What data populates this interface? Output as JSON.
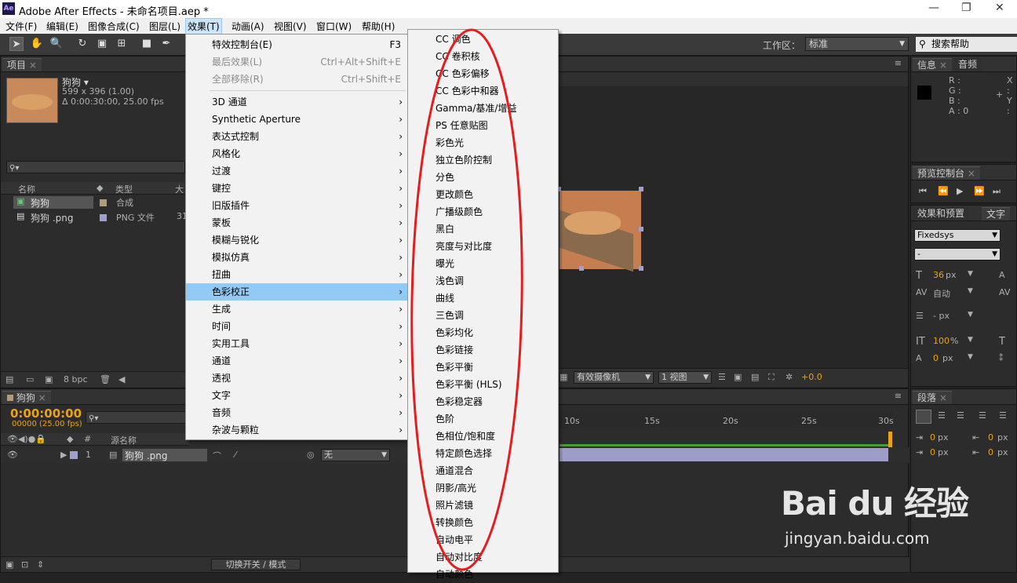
{
  "window": {
    "title": "Adobe After Effects - 未命名项目.aep *",
    "logo_text": "Ae",
    "minimize": "—",
    "restore": "❐",
    "close": "✕"
  },
  "menubar": {
    "items": [
      "文件(F)",
      "编辑(E)",
      "图像合成(C)",
      "图层(L)",
      "效果(T)",
      "动画(A)",
      "视图(V)",
      "窗口(W)",
      "帮助(H)"
    ]
  },
  "toolbar": {
    "workspace_label": "工作区：",
    "workspace_value": "标准",
    "search_placeholder": "搜索帮助"
  },
  "project_panel": {
    "tab": "项目",
    "item_name": "狗狗 ▾",
    "item_size": "599 x 396 (1.00)",
    "item_duration": "Δ 0:00:30:00, 25.00 fps",
    "col_name": "名称",
    "col_type": "类型",
    "col_size": "大",
    "rows": [
      {
        "name": "狗狗",
        "type": "合成",
        "size": ""
      },
      {
        "name": "狗狗 .png",
        "type": "PNG 文件",
        "size": "31"
      }
    ],
    "bpc": "8 bpc"
  },
  "effects_menu": {
    "items": [
      {
        "label": "特效控制台(E)",
        "shortcut": "F3",
        "disabled": false,
        "submenu": false
      },
      {
        "label": "最后效果(L)",
        "shortcut": "Ctrl+Alt+Shift+E",
        "disabled": true,
        "submenu": false
      },
      {
        "label": "全部移除(R)",
        "shortcut": "Ctrl+Shift+E",
        "disabled": true,
        "submenu": false
      },
      {
        "label": "3D 通道",
        "submenu": true
      },
      {
        "label": "Synthetic Aperture",
        "submenu": true
      },
      {
        "label": "表达式控制",
        "submenu": true
      },
      {
        "label": "风格化",
        "submenu": true
      },
      {
        "label": "过渡",
        "submenu": true
      },
      {
        "label": "键控",
        "submenu": true
      },
      {
        "label": "旧版插件",
        "submenu": true
      },
      {
        "label": "蒙板",
        "submenu": true
      },
      {
        "label": "模糊与锐化",
        "submenu": true
      },
      {
        "label": "模拟仿真",
        "submenu": true
      },
      {
        "label": "扭曲",
        "submenu": true
      },
      {
        "label": "色彩校正",
        "submenu": true,
        "highlighted": true
      },
      {
        "label": "生成",
        "submenu": true
      },
      {
        "label": "时间",
        "submenu": true
      },
      {
        "label": "实用工具",
        "submenu": true
      },
      {
        "label": "通道",
        "submenu": true
      },
      {
        "label": "透视",
        "submenu": true
      },
      {
        "label": "文字",
        "submenu": true
      },
      {
        "label": "音频",
        "submenu": true
      },
      {
        "label": "杂波与颗粒",
        "submenu": true
      }
    ],
    "arrow": "›"
  },
  "color_submenu": {
    "items": [
      "CC 调色",
      "CC 卷积核",
      "CC 色彩偏移",
      "CC 色彩中和器",
      "Gamma/基准/增益",
      "PS 任意贴图",
      "彩色光",
      "独立色阶控制",
      "分色",
      "更改颜色",
      "广播级颜色",
      "黑白",
      "亮度与对比度",
      "曝光",
      "浅色调",
      "曲线",
      "三色调",
      "色彩均化",
      "色彩链接",
      "色彩平衡",
      "色彩平衡 (HLS)",
      "色彩稳定器",
      "色阶",
      "色相位/饱和度",
      "特定颜色选择",
      "通道混合",
      "阴影/高光",
      "照片滤镜",
      "转换颜色",
      "自动电平",
      "自动对比度",
      "自动颜色"
    ]
  },
  "viewer": {
    "camera": "有效摄像机",
    "views": "1 视图",
    "exposure": "+0.0"
  },
  "info_panel": {
    "tab_info": "信息",
    "tab_audio": "音频",
    "r": "R :",
    "g": "G :",
    "b": "B :",
    "a": "A : 0",
    "x": "X :",
    "y": "Y :"
  },
  "preview_panel": {
    "tab": "预览控制台"
  },
  "character_panel": {
    "tab_effects": "效果和预置",
    "tab_text": "文字",
    "font": "Fixedsys",
    "style": "-",
    "size": "36",
    "px": "px",
    "leading": "自动",
    "tracking_px": "- px",
    "scale": "100",
    "percent": "%",
    "baseline": "0",
    "baseline_px": "px"
  },
  "paragraph_panel": {
    "tab": "段落",
    "v1": "0",
    "v2": "0",
    "v3": "0",
    "v4": "0",
    "unit": "px"
  },
  "timeline": {
    "tab": "狗狗",
    "timecode": "0:00:00:00",
    "frames": "00000 (25.00 fps)",
    "col_source": "源名称",
    "col_num": "#",
    "layer_num": "1",
    "layer_name": "狗狗 .png",
    "parent": "无",
    "switch_label": "切换开关 / 模式",
    "ruler": [
      "10s",
      "15s",
      "20s",
      "25s",
      "30s"
    ]
  },
  "watermark": {
    "brand": "Bai du 经验",
    "url": "jingyan.baidu.com"
  },
  "colors": {
    "accent_orange": "#e8a318",
    "menu_highlight": "#91c9f7",
    "annotation_red": "#e02020"
  }
}
